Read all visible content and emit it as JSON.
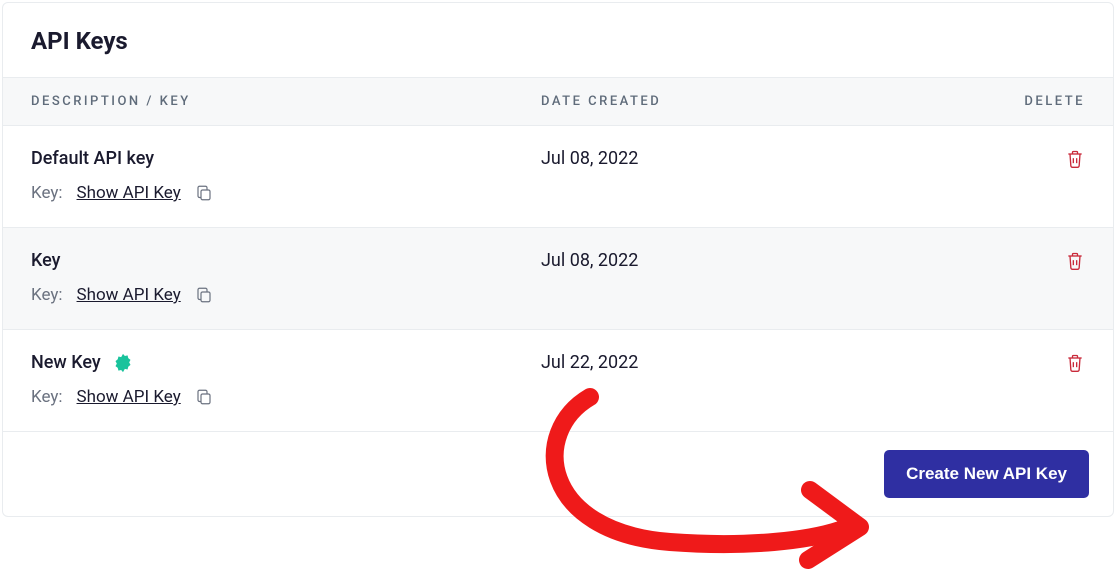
{
  "title": "API Keys",
  "columns": {
    "desc": "DESCRIPTION / KEY",
    "date": "DATE CREATED",
    "delete": "DELETE"
  },
  "key_prefix": "Key:",
  "show_label": "Show API Key",
  "rows": [
    {
      "name": "Default API key",
      "date": "Jul 08, 2022",
      "badge": false,
      "alt": false
    },
    {
      "name": "Key",
      "date": "Jul 08, 2022",
      "badge": false,
      "alt": true
    },
    {
      "name": "New Key",
      "date": "Jul 22, 2022",
      "badge": true,
      "alt": false
    }
  ],
  "create_button": "Create New API Key"
}
